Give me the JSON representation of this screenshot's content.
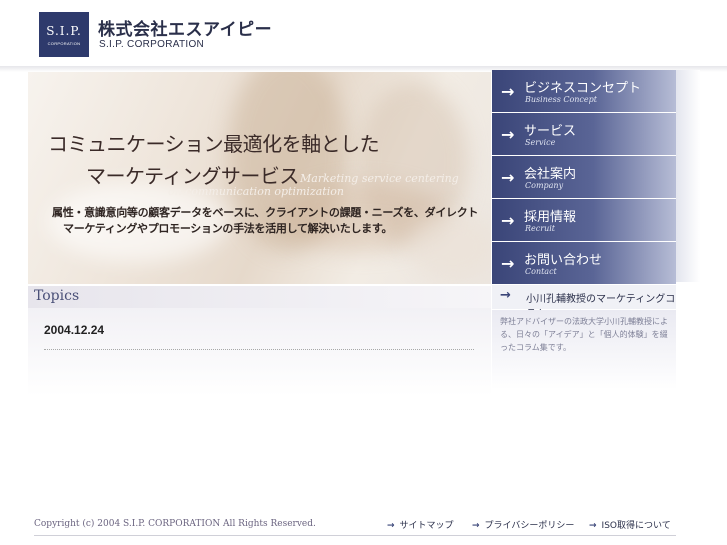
{
  "header": {
    "logo_mark": "S.I.P.",
    "logo_sub": "CORPORATION",
    "company_jp": "株式会社エスアイピー",
    "company_en": "S.I.P. CORPORATION"
  },
  "hero": {
    "title_line1": "コミュニケーション最適化を軸とした",
    "title_line2": "マーケティングサービス",
    "en_line1": "Marketing service centering",
    "en_line2": "on communication optimization",
    "desc_line1": "属性・意識意向等の顧客データをベースに、クライアントの課題・ニーズを、ダイレクト",
    "desc_line2": "マーケティングやプロモーションの手法を活用して解決いたします。"
  },
  "nav": {
    "arrow": "→",
    "items": [
      {
        "jp": "ビジネスコンセプト",
        "en": "Business Concept"
      },
      {
        "jp": "サービス",
        "en": "Service"
      },
      {
        "jp": "会社案内",
        "en": "Company"
      },
      {
        "jp": "採用情報",
        "en": "Recruit"
      },
      {
        "jp": "お問い合わせ",
        "en": "Contact"
      }
    ]
  },
  "column": {
    "arrow": "→",
    "label": "小川孔輔教授のマーケティングコラム",
    "description": "弊社アドバイザーの法政大学小川孔輔教授による、日々の「アイデア」と「個人的体験」を綴ったコラム集です。"
  },
  "topics": {
    "title": "Topics",
    "date": "2004.12.24"
  },
  "footer": {
    "copyright": "Copyright (c) 2004 S.I.P. CORPORATION All Rights Reserved.",
    "arrow": "→",
    "links": [
      "サイトマップ",
      "プライバシーポリシー",
      "ISO取得について"
    ]
  },
  "colors": {
    "brand_navy": "#2e3a6c",
    "nav_dark": "#3a4578",
    "nav_light": "#b7bdd6"
  }
}
